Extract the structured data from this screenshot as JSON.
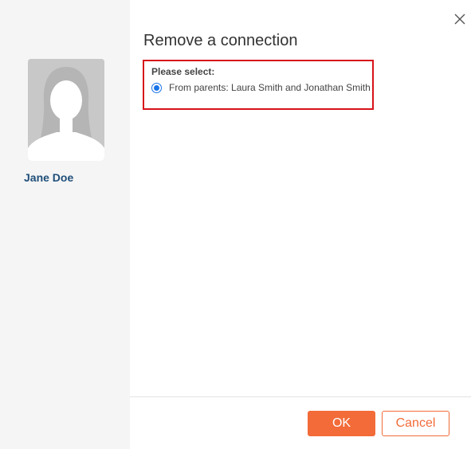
{
  "dialog": {
    "title": "Remove a connection",
    "close_icon": "close-icon"
  },
  "profile": {
    "name": "Jane Doe",
    "avatar_icon": "female-silhouette-icon"
  },
  "selection": {
    "label": "Please select:",
    "options": [
      {
        "text": "From parents: Laura Smith and Jonathan Smith",
        "selected": true
      }
    ]
  },
  "footer": {
    "ok_label": "OK",
    "cancel_label": "Cancel"
  },
  "colors": {
    "accent": "#f26b38",
    "highlight_border": "#d7141a",
    "radio": "#1a73e8",
    "name": "#1f4e79"
  }
}
